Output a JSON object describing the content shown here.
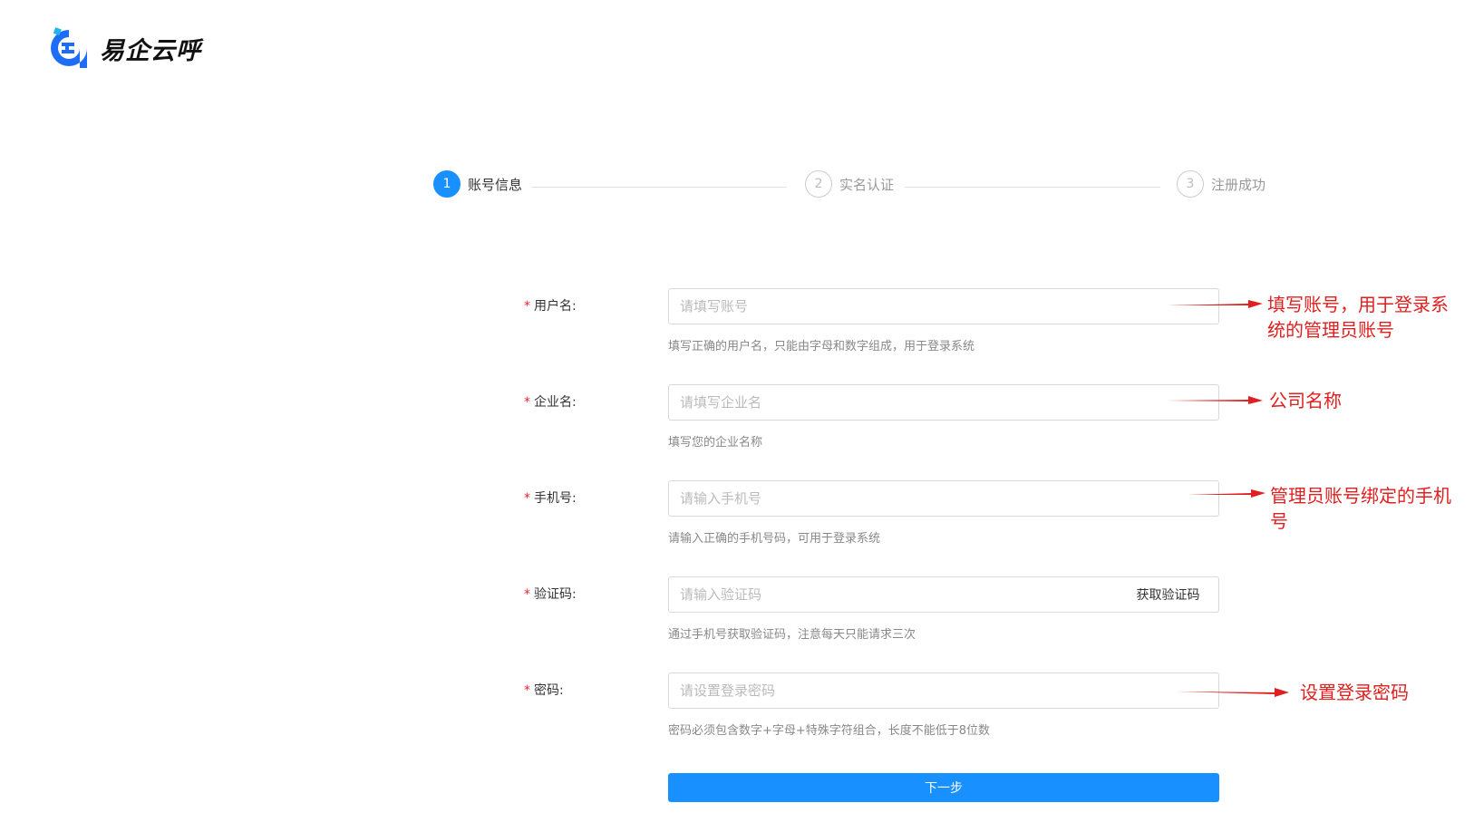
{
  "brand": {
    "name": "易企云呼",
    "primary_color": "#1890ff",
    "logo_icon": "brand-logo-icon"
  },
  "steps": [
    {
      "number": "1",
      "label": "账号信息",
      "state": "active"
    },
    {
      "number": "2",
      "label": "实名认证",
      "state": "wait"
    },
    {
      "number": "3",
      "label": "注册成功",
      "state": "wait"
    }
  ],
  "form": {
    "username": {
      "required_mark": "*",
      "label": "用户名:",
      "placeholder": "请填写账号",
      "hint": "填写正确的用户名，只能由字母和数字组成，用于登录系统"
    },
    "company": {
      "required_mark": "*",
      "label": "企业名:",
      "placeholder": "请填写企业名",
      "hint": "填写您的企业名称"
    },
    "phone": {
      "required_mark": "*",
      "label": "手机号:",
      "placeholder": "请输入手机号",
      "hint": "请输入正确的手机号码，可用于登录系统"
    },
    "code": {
      "required_mark": "*",
      "label": "验证码:",
      "placeholder": "请输入验证码",
      "button": "获取验证码",
      "hint": "通过手机号获取验证码，注意每天只能请求三次"
    },
    "password": {
      "required_mark": "*",
      "label": "密码:",
      "placeholder": "请设置登录密码",
      "hint": "密码必须包含数字+字母+特殊字符组合，长度不能低于8位数"
    },
    "next_button": "下一步"
  },
  "annotations": {
    "color": "#e02020",
    "username_note_line1": "填写账号，用于登录系",
    "username_note_line2": "统的管理员账号",
    "company_note": "公司名称",
    "phone_note_line1": "管理员账号绑定的手机",
    "phone_note_line2": "号",
    "password_note": "设置登录密码"
  }
}
